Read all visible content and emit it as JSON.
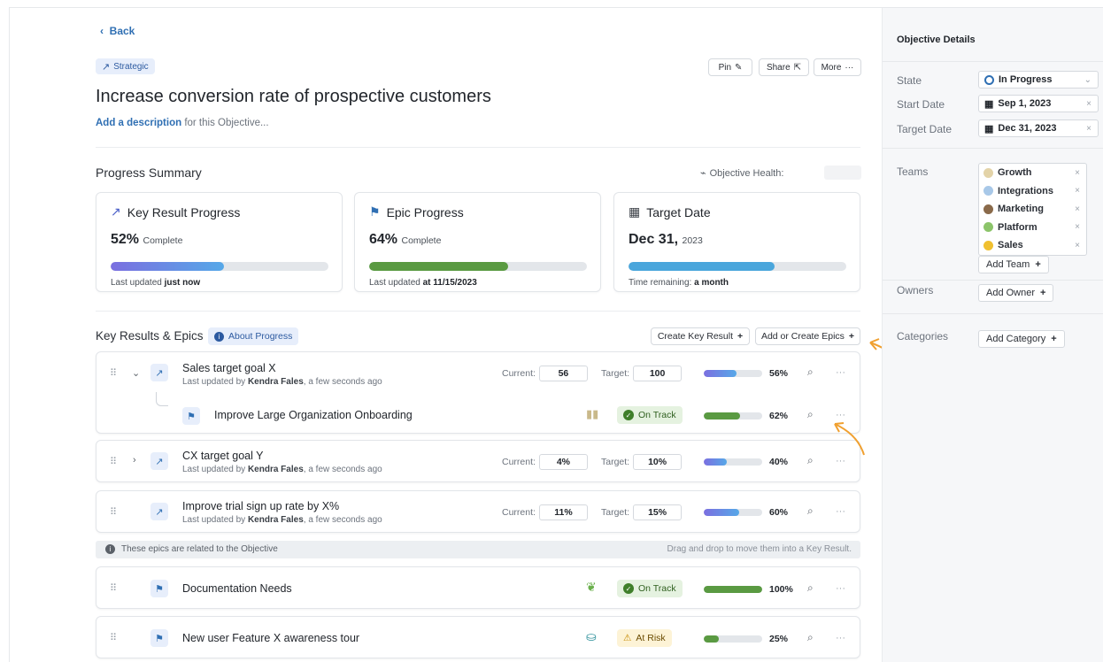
{
  "nav": {
    "back": "Back"
  },
  "tag": "Strategic",
  "title": "Increase conversion rate of prospective customers",
  "description": {
    "link": "Add a description",
    "rest": " for this Objective..."
  },
  "actions": {
    "pin": "Pin",
    "share": "Share",
    "more": "More"
  },
  "progress_summary": {
    "heading": "Progress Summary",
    "health_label": "Objective Health:",
    "cards": [
      {
        "title": "Key Result Progress",
        "value": "52%",
        "value_suffix": "Complete",
        "fraction": 0.52,
        "footer_prefix": "Last updated ",
        "footer_bold": "just now",
        "color": "#6a7fe0"
      },
      {
        "title": "Epic Progress",
        "value": "64%",
        "value_suffix": "Complete",
        "fraction": 0.64,
        "footer_prefix": "Last updated ",
        "footer_bold": "at 11/15/2023",
        "color": "#5a9a42"
      },
      {
        "title": "Target Date",
        "value": "Dec 31,",
        "value_suffix": "2023",
        "fraction": 0.67,
        "footer_prefix": "Time remaining: ",
        "footer_bold": "a month",
        "color": "#4aa6dc"
      }
    ]
  },
  "kr_section": {
    "heading": "Key Results & Epics",
    "about": "About Progress",
    "create_kr": "Create Key Result",
    "add_epics": "Add or Create Epics",
    "current_label": "Current:",
    "target_label": "Target:",
    "updated_prefix": "Last updated by ",
    "updated_user": "Kendra Fales",
    "updated_suffix": ", a few seconds ago",
    "key_results": [
      {
        "name": "Sales target goal X",
        "current": "56",
        "target": "100",
        "pct": "56%",
        "fraction": 0.56
      },
      {
        "name": "CX target goal Y",
        "current": "4%",
        "target": "10%",
        "pct": "40%",
        "fraction": 0.4
      },
      {
        "name": "Improve trial sign up rate by X%",
        "current": "11%",
        "target": "15%",
        "pct": "60%",
        "fraction": 0.6
      }
    ],
    "child_epic": {
      "name": "Improve Large Organization Onboarding",
      "status": "On Track",
      "pct": "62%",
      "fraction": 0.62
    },
    "notice_left": "These epics are related to the Objective",
    "notice_right": "Drag and drop to move them into a Key Result.",
    "epics": [
      {
        "name": "Documentation Needs",
        "status": "On Track",
        "pct": "100%",
        "fraction": 1.0
      },
      {
        "name": "New user Feature X awareness tour",
        "status": "At Risk",
        "pct": "25%",
        "fraction": 0.25
      }
    ]
  },
  "sidebar": {
    "heading": "Objective Details",
    "state_label": "State",
    "state_value": "In Progress",
    "start_label": "Start Date",
    "start_value": "Sep 1, 2023",
    "target_label": "Target Date",
    "target_value": "Dec 31, 2023",
    "teams_label": "Teams",
    "teams": [
      "Growth",
      "Integrations",
      "Marketing",
      "Platform",
      "Sales"
    ],
    "add_team": "Add Team",
    "owners_label": "Owners",
    "add_owner": "Add Owner",
    "categories_label": "Categories",
    "add_category": "Add Category"
  },
  "colors": {
    "accent": "#2f6fb3",
    "kr_bar": "#6a7fe0",
    "epic_bar": "#5a9a42",
    "date_bar": "#4aa6dc",
    "annotation_arrow": "#f0a030"
  }
}
